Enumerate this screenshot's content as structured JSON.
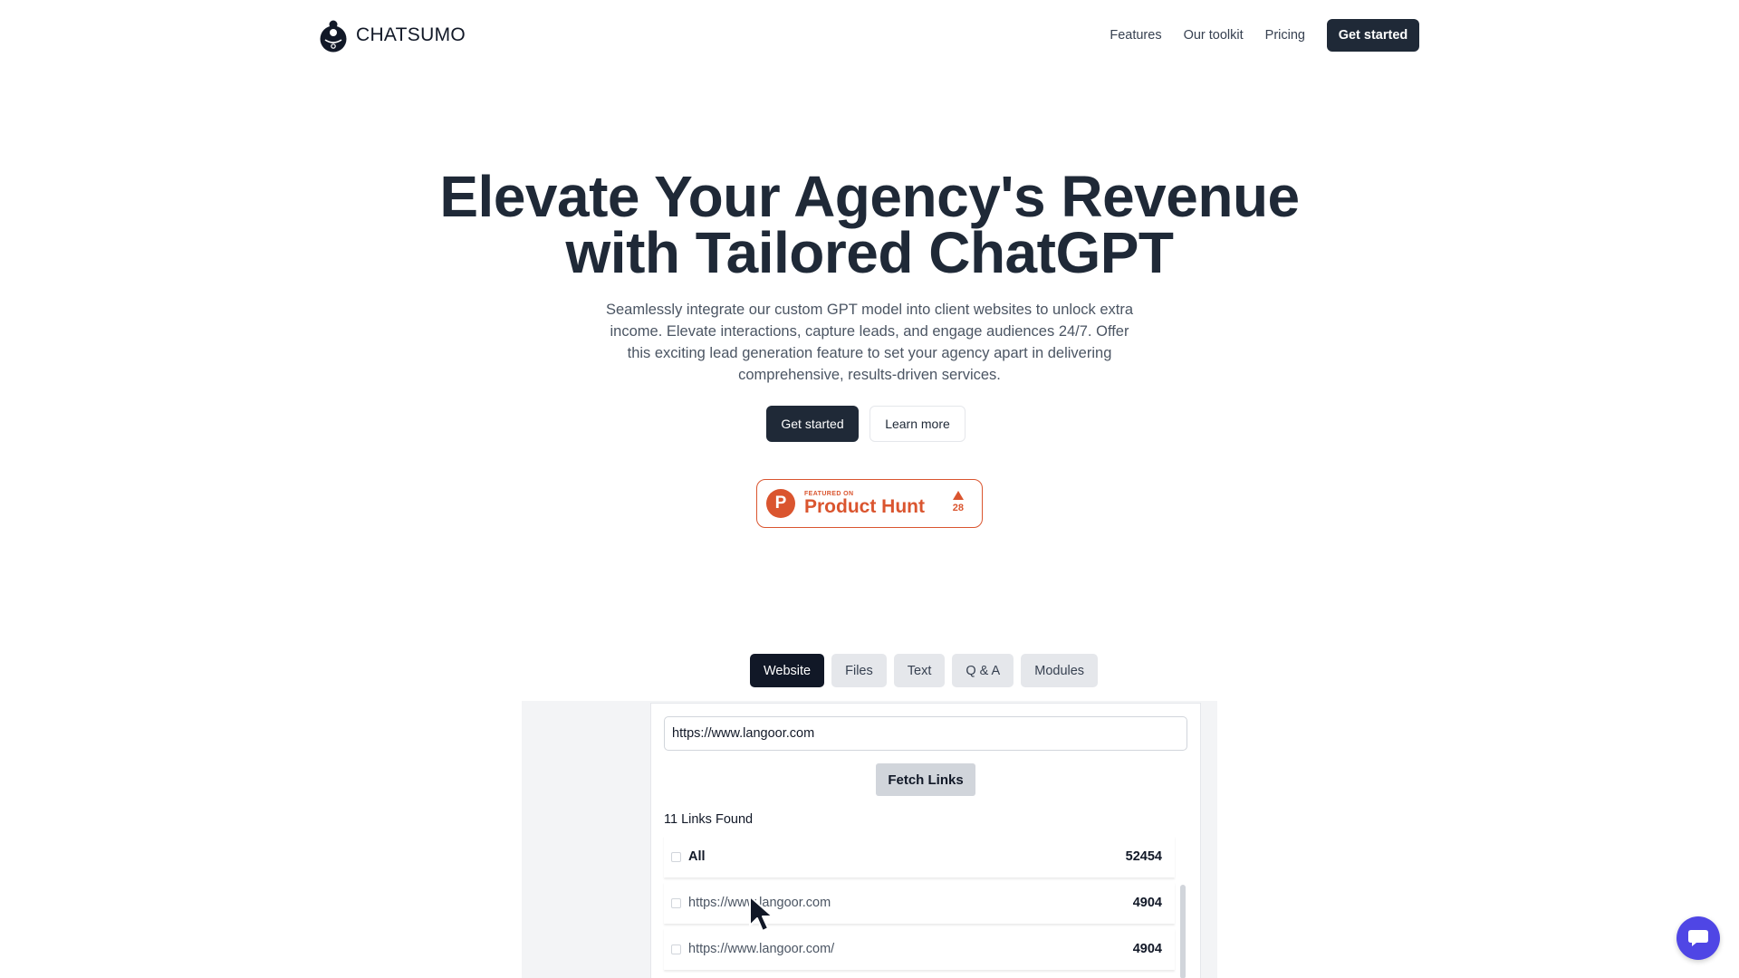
{
  "header": {
    "brand": "CHATSUMO",
    "logo_icon": "sumo-wrestler-icon",
    "nav": [
      {
        "label": "Features"
      },
      {
        "label": "Our toolkit"
      },
      {
        "label": "Pricing"
      }
    ],
    "cta_label": "Get started"
  },
  "hero": {
    "title_line1": "Elevate Your Agency's Revenue",
    "title_line2": "with Tailored ChatGPT",
    "subtitle": "Seamlessly integrate our custom GPT model into client websites to unlock extra income. Elevate interactions, capture leads, and engage audiences 24/7. Offer this exciting lead generation feature to set your agency apart in delivering comprehensive, results-driven services.",
    "primary_label": "Get started",
    "secondary_label": "Learn more"
  },
  "product_hunt": {
    "logo_letter": "P",
    "small_text": "FEATURED ON",
    "big_text": "Product Hunt",
    "votes": "28",
    "color": "#da552f"
  },
  "demo": {
    "tabs": [
      {
        "label": "Website",
        "active": true
      },
      {
        "label": "Files"
      },
      {
        "label": "Text"
      },
      {
        "label": "Q & A"
      },
      {
        "label": "Modules"
      }
    ],
    "url_value": "https://www.langoor.com",
    "fetch_label": "Fetch Links",
    "links_found": "11 Links Found",
    "rows": [
      {
        "url": "All",
        "count": "52454"
      },
      {
        "url": "https://www.langoor.com",
        "count": "4904"
      },
      {
        "url": "https://www.langoor.com/",
        "count": "4904"
      }
    ]
  },
  "chat_widget": {
    "icon": "chat-bubble-icon",
    "color": "#4f46e5"
  }
}
